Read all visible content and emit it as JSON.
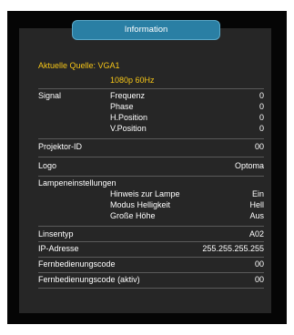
{
  "header": {
    "title": "Information"
  },
  "source": {
    "label": "Aktuelle Quelle: VGA1",
    "resolution": "1080p 60Hz"
  },
  "signal": {
    "label": "Signal",
    "rows": [
      {
        "label": "Frequenz",
        "value": "0"
      },
      {
        "label": "Phase",
        "value": "0"
      },
      {
        "label": "H.Position",
        "value": "0"
      },
      {
        "label": "V.Position",
        "value": "0"
      }
    ]
  },
  "projector_id": {
    "label": "Projektor-ID",
    "value": "00"
  },
  "logo": {
    "label": "Logo",
    "value": "Optoma"
  },
  "lamp": {
    "label": "Lampeneinstellungen",
    "rows": [
      {
        "label": "Hinweis zur Lampe",
        "value": "Ein"
      },
      {
        "label": "Modus Helligkeit",
        "value": "Hell"
      },
      {
        "label": "Große Höhe",
        "value": "Aus"
      }
    ]
  },
  "lens_type": {
    "label": "Linsentyp",
    "value": "A02"
  },
  "ip_address": {
    "label": "IP-Adresse",
    "value": "255.255.255.255"
  },
  "remote_code": {
    "label": "Fernbedienungscode",
    "value": "00"
  },
  "remote_code_active": {
    "label": "Fernbedienungscode (aktiv)",
    "value": "00"
  },
  "colors": {
    "accent_tab": "#2a7fa4",
    "highlight_text": "#f5c518",
    "panel": "#262626",
    "background": "#050505"
  }
}
